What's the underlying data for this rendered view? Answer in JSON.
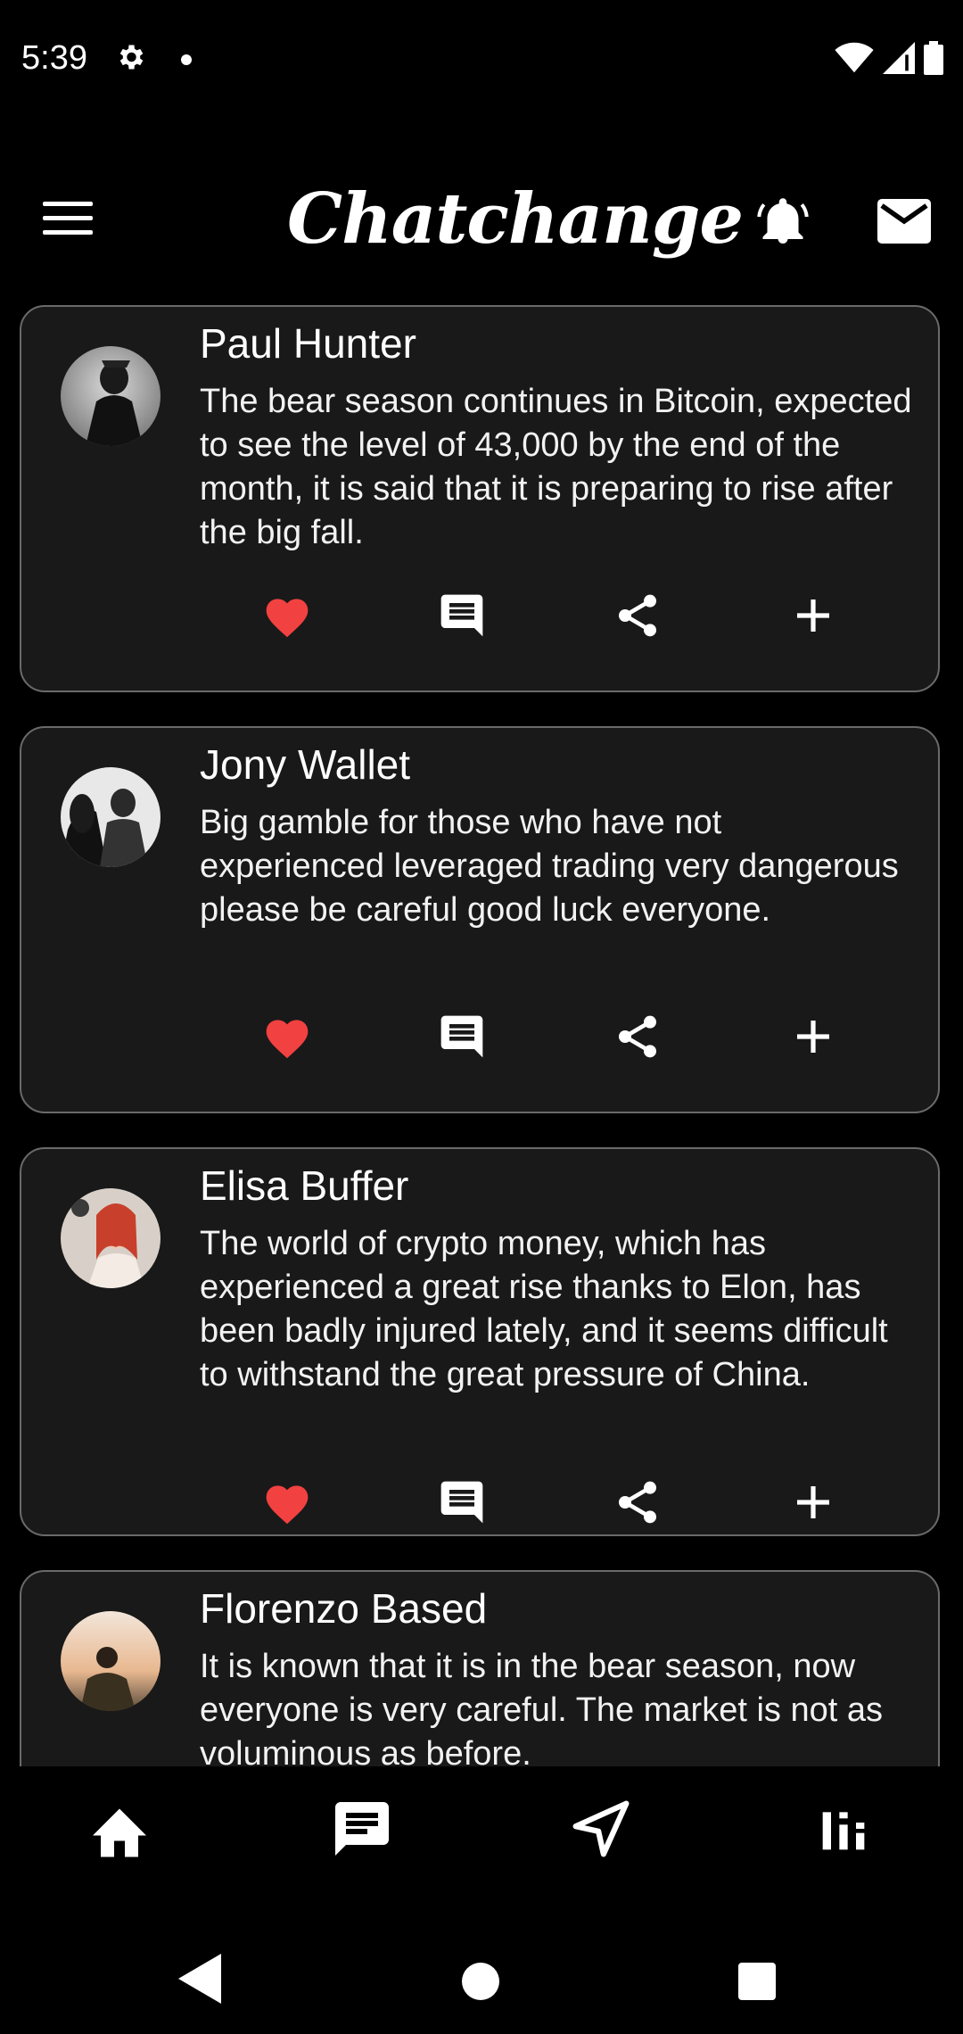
{
  "status": {
    "time": "5:39"
  },
  "app": {
    "title": "Chatchange"
  },
  "colors": {
    "background": "#000000",
    "card": "#191919",
    "card_border": "#6a6a6a",
    "like": "#f24141",
    "text": "#ffffff"
  },
  "icons": {
    "menu": "hamburger-icon",
    "bell": "bell-icon",
    "mail": "mail-icon",
    "like": "heart-icon",
    "comment": "comment-icon",
    "share": "share-icon",
    "add": "plus-icon",
    "nav": [
      "home-icon",
      "chat-icon",
      "send-icon",
      "stats-icon"
    ]
  },
  "posts": [
    {
      "author": "Paul Hunter",
      "text": "The bear season continues in Bitcoin, expected to see the level of 43,000 by the end of the month, it is said that it is preparing to rise after the big fall."
    },
    {
      "author": "Jony Wallet",
      "text": "Big gamble for those who have not experienced leveraged trading very dangerous please be careful good luck everyone."
    },
    {
      "author": "Elisa Buffer",
      "text": "The world of crypto money, which has experienced a great rise thanks to Elon, has been badly injured lately, and it seems difficult to withstand the great pressure of China."
    },
    {
      "author": "Florenzo Based",
      "text": "It is known that it is in the bear season, now everyone is very careful. The market is not as voluminous as before."
    }
  ]
}
